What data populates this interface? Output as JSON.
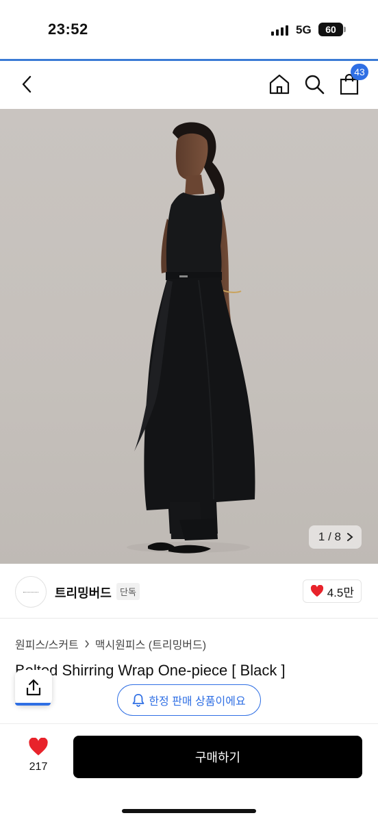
{
  "status_bar": {
    "time": "23:52",
    "network": "5G",
    "battery": "60"
  },
  "nav": {
    "cart_count": "43"
  },
  "gallery": {
    "current": "1",
    "total": "8",
    "separator": "/"
  },
  "shop": {
    "name": "트리밍버드",
    "tag": "단독",
    "rating": "4.5만"
  },
  "breadcrumb": {
    "category": "원피스/스커트",
    "subcategory": "맥시원피스 (트리밍버드)"
  },
  "product": {
    "title": "Belted Shirring Wrap One-piece [ Black ]"
  },
  "notice": {
    "limited_label": "한정 판매 상품이에요"
  },
  "bottom_bar": {
    "like_count": "217",
    "buy_label": "구매하기"
  },
  "colors": {
    "accent": "#2f6fe4",
    "heart": "#e8232b",
    "buy_button": "#000000",
    "dress": "#17181a"
  }
}
